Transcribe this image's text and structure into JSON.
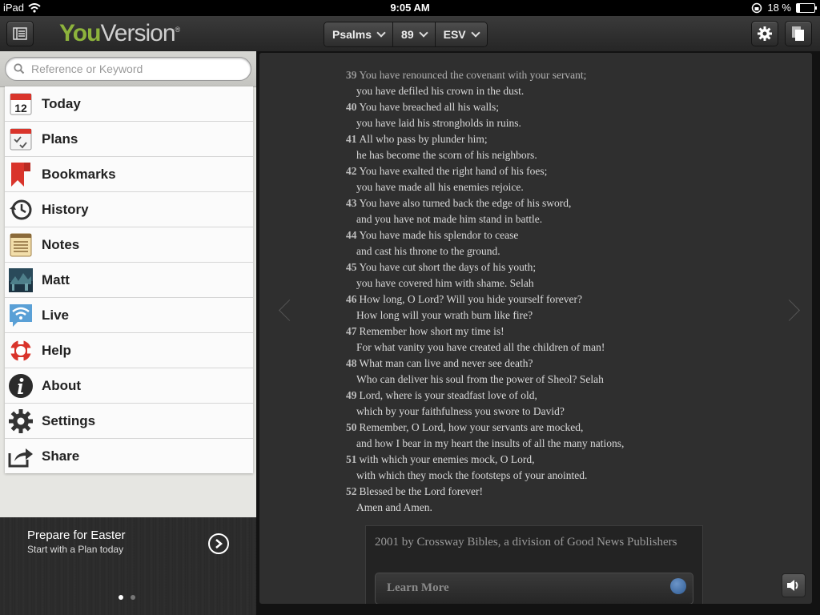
{
  "status": {
    "device": "iPad",
    "time": "9:05 AM",
    "battery": "18 %",
    "battery_level": 0.18
  },
  "header": {
    "logo_you": "You",
    "logo_version": "Version",
    "logo_mark": "®",
    "book": "Psalms",
    "chapter": "89",
    "version": "ESV"
  },
  "search": {
    "placeholder": "Reference or Keyword"
  },
  "sidebar": {
    "items": [
      {
        "label": "Today",
        "icon": "calendar-icon",
        "icon_text": "12"
      },
      {
        "label": "Plans",
        "icon": "checklist-icon"
      },
      {
        "label": "Bookmarks",
        "icon": "bookmark-icon"
      },
      {
        "label": "History",
        "icon": "history-icon"
      },
      {
        "label": "Notes",
        "icon": "notes-icon"
      },
      {
        "label": "Matt",
        "icon": "profile-photo-icon"
      },
      {
        "label": "Live",
        "icon": "wifi-icon"
      },
      {
        "label": "Help",
        "icon": "lifebuoy-icon"
      },
      {
        "label": "About",
        "icon": "info-icon"
      },
      {
        "label": "Settings",
        "icon": "gear-icon"
      },
      {
        "label": "Share",
        "icon": "share-icon"
      }
    ]
  },
  "promo": {
    "title": "Prepare for Easter",
    "subtitle": "Start with a Plan today"
  },
  "verses": [
    {
      "num": "39",
      "line1": "You have renounced the covenant with your servant;",
      "line2": "you have defiled his crown in the dust."
    },
    {
      "num": "40",
      "line1": "You have breached all his walls;",
      "line2": "you have laid his strongholds in ruins."
    },
    {
      "num": "41",
      "line1": "All who pass by plunder him;",
      "line2": "he has become the scorn of his neighbors."
    },
    {
      "num": "42",
      "line1": "You have exalted the right hand of his foes;",
      "line2": "you have made all his enemies rejoice."
    },
    {
      "num": "43",
      "line1": "You have also turned back the edge of his sword,",
      "line2": "and you have not made him stand in battle."
    },
    {
      "num": "44",
      "line1": "You have made his splendor to cease",
      "line2": "and cast his throne to the ground."
    },
    {
      "num": "45",
      "line1": "You have cut short the days of his youth;",
      "line2": "you have covered him with shame. Selah"
    },
    {
      "num": "46",
      "line1": "How long, O Lord? Will you hide yourself forever?",
      "line2": "How long will your wrath burn like fire?"
    },
    {
      "num": "47",
      "line1": "Remember how short my time is!",
      "line2": "For what vanity you have created all the children of man!"
    },
    {
      "num": "48",
      "line1": "What man can live and never see death?",
      "line2": "Who can deliver his soul from the power of Sheol? Selah"
    },
    {
      "num": "49",
      "line1": "Lord, where is your steadfast love of old,",
      "line2": "which by your faithfulness you swore to David?"
    },
    {
      "num": "50",
      "line1": "Remember, O Lord, how your servants are mocked,",
      "line2": "and how I bear in my heart the insults of all the many nations,"
    },
    {
      "num": "51",
      "line1": "with which your enemies mock, O Lord,",
      "line2": "with which they mock the footsteps of your anointed."
    },
    {
      "num": "52",
      "line1": "Blessed be the Lord forever!",
      "line2": "Amen and Amen."
    }
  ],
  "copyright": {
    "text": "2001 by Crossway Bibles, a division of Good News Publishers",
    "button": "Learn More"
  },
  "colors": {
    "brand_green": "#8db33c",
    "page_bg": "#2f2f2f",
    "verse_text": "#d9d9d9"
  }
}
